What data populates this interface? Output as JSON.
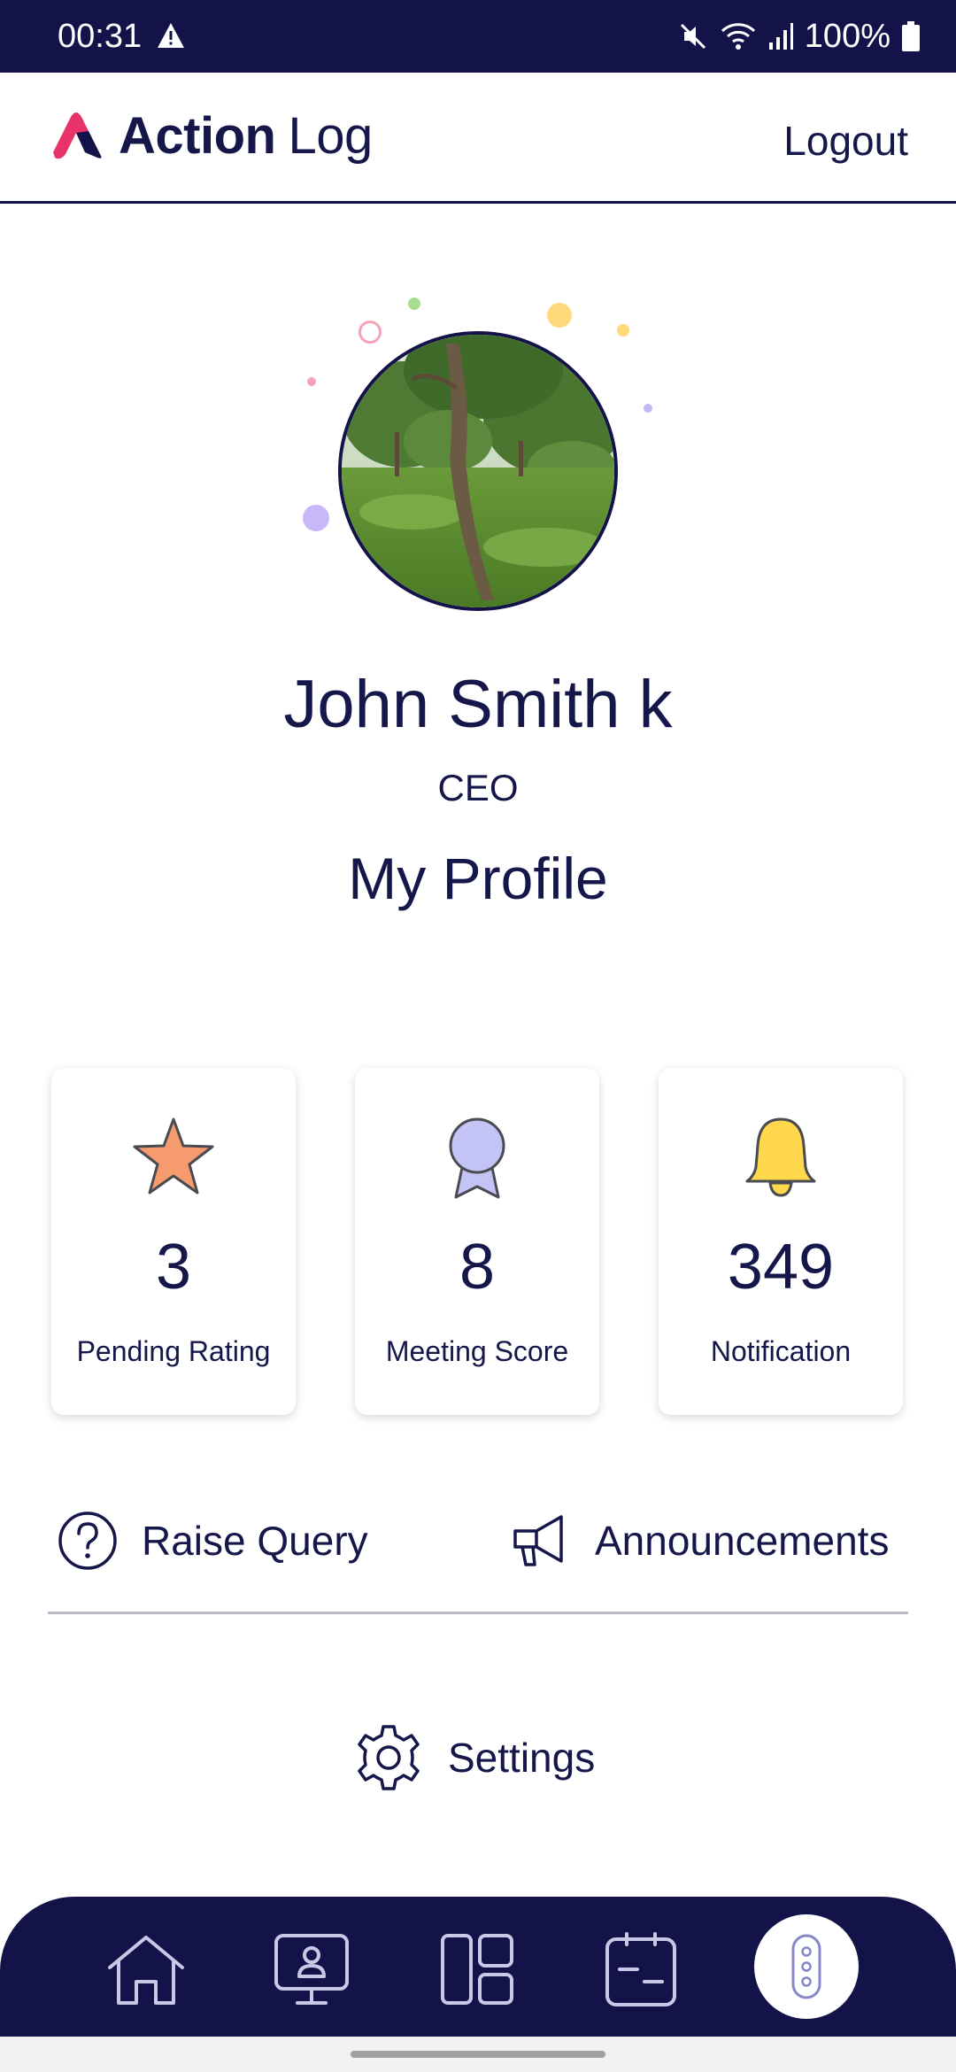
{
  "status_bar": {
    "time": "00:31",
    "battery": "100%",
    "icons": [
      "warning-icon",
      "mute-icon",
      "wifi-icon",
      "signal-icon",
      "battery-icon"
    ]
  },
  "header": {
    "logo_action": "Action",
    "logo_log": "Log",
    "logout_label": "Logout"
  },
  "profile": {
    "name": "John Smith k",
    "role": "CEO",
    "heading": "My Profile"
  },
  "stats": [
    {
      "value": "3",
      "label": "Pending Rating",
      "icon": "star-icon",
      "color": "#f59b6e"
    },
    {
      "value": "8",
      "label": "Meeting Score",
      "icon": "award-ribbon-icon",
      "color": "#c3c4f5"
    },
    {
      "value": "349",
      "label": "Notification",
      "icon": "bell-icon",
      "color": "#ffd84d"
    }
  ],
  "actions": {
    "raise_query": "Raise Query",
    "announcements": "Announcements",
    "settings": "Settings"
  },
  "bottom_nav": {
    "items": [
      "home-icon",
      "presentation-icon",
      "dashboard-icon",
      "calendar-icon",
      "more-vertical-icon"
    ]
  },
  "colors": {
    "primary": "#13134a",
    "brand_pink": "#e8336a",
    "divider": "#b9b9c6"
  }
}
